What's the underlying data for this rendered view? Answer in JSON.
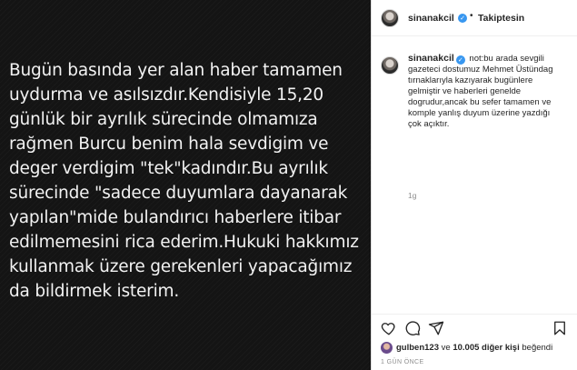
{
  "post": {
    "image_text_lines": [
      "Bugün basında yer alan haber tamamen",
      "uydurma ve asılsızdır.Kendisiyle 15,20",
      "günlük bir ayrılık sürecinde olmamıza",
      "rağmen Burcu benim hala sevdigim ve",
      "deger verdigim \"tek\"kadındır.Bu ayrılık",
      "sürecinde \"sadece duyumlara dayanarak",
      "yapılan\"mide bulandırıcı haberlere itibar",
      "edilmemesini rica ederim.Hukuki hakkımız",
      "kullanmak üzere gerekenleri yapacağımız",
      "da bildirmek isterim."
    ]
  },
  "header": {
    "username": "sinanakcil",
    "verified_glyph": "✓",
    "separator": "•",
    "follow_status": "Takiptesin"
  },
  "caption": {
    "username": "sinanakcil",
    "verified_glyph": "✓",
    "lines": [
      "not:bu arada sevgili",
      "gazeteci dostumuz Mehmet Üstündag",
      "tırnaklarıyla kazıyarak bugünlere",
      "gelmiştir ve haberleri genelde",
      "dogrudur,ancak bu sefer tamamen ve",
      "komple yanlış duyum üzerine yazdığı",
      "çok açıktır."
    ],
    "time": "1g"
  },
  "actions": {
    "icons": [
      "heart-icon",
      "comment-icon",
      "share-icon",
      "bookmark-icon"
    ]
  },
  "likes": {
    "liker": "gulben123",
    "connector": "ve",
    "count_text": "10.005 diğer kişi",
    "suffix": "beğendi"
  },
  "post_date": "1 GÜN ÖNCE",
  "colors": {
    "image_background": "#141414",
    "image_text": "#f2f2f2",
    "verified_blue": "#3897f0",
    "text_primary": "#262626",
    "text_secondary": "#8e8e8e",
    "divider": "#efefef"
  }
}
